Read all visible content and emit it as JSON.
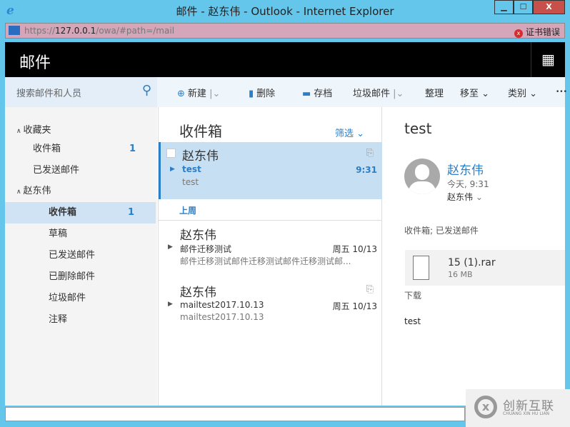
{
  "window": {
    "title": "邮件 - 赵东伟 - Outlook - Internet Explorer",
    "minimize": "▁",
    "maximize": "☐",
    "close": "X"
  },
  "address": {
    "scheme": "https://",
    "host": "127.0.0.1",
    "path": "/owa/#path=/mail",
    "cert_error": "证书错误"
  },
  "app": {
    "title": "邮件"
  },
  "search": {
    "placeholder": "搜索邮件和人员"
  },
  "toolbar": {
    "new": "新建",
    "delete": "删除",
    "archive": "存档",
    "junk": "垃圾邮件",
    "sweep": "整理",
    "move": "移至",
    "category": "类别",
    "more": "•••"
  },
  "nav": {
    "favorites": "收藏夹",
    "fav_inbox": "收件箱",
    "fav_inbox_count": "1",
    "fav_sent": "已发送邮件",
    "account": "赵东伟",
    "inbox": "收件箱",
    "inbox_count": "1",
    "drafts": "草稿",
    "sent": "已发送邮件",
    "deleted": "已删除邮件",
    "junk": "垃圾邮件",
    "notes": "注释"
  },
  "list": {
    "title": "收件箱",
    "filter": "筛选",
    "group_last_week": "上周",
    "messages": [
      {
        "from": "赵东伟",
        "subject": "test",
        "preview": "test",
        "date": "9:31"
      },
      {
        "from": "赵东伟",
        "subject": "邮件迁移测试",
        "preview": "邮件迁移测试邮件迁移测试邮件迁移测试邮...",
        "date": "周五 10/13"
      },
      {
        "from": "赵东伟",
        "subject": "mailtest2017.10.13",
        "preview": "mailtest2017.10.13",
        "date": "周五 10/13"
      }
    ]
  },
  "reading": {
    "subject": "test",
    "sender": "赵东伟",
    "time": "今天, 9:31",
    "to": "赵东伟",
    "folders": "收件箱; 已发送邮件",
    "attachment_name": "15 (1).rar",
    "attachment_size": "16 MB",
    "download": "下载",
    "body": "test"
  },
  "watermark": {
    "text": "创新互联",
    "sub": "CHUANG XIN HU LIAN"
  }
}
